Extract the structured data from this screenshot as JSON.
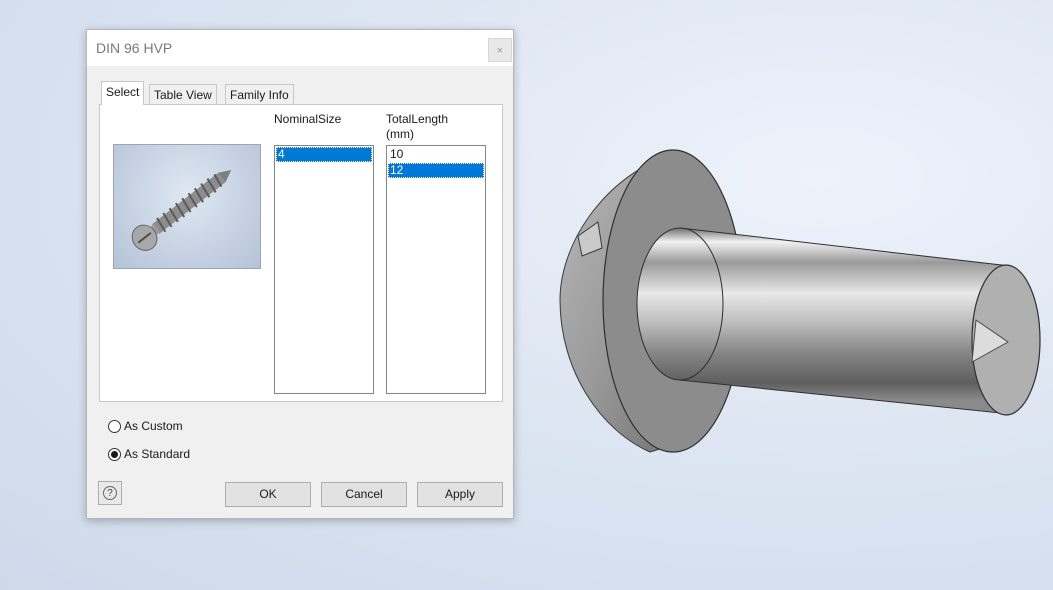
{
  "dialog": {
    "title": "DIN 96 HVP",
    "close_glyph": "×",
    "tabs": [
      {
        "label": "Select",
        "active": true
      },
      {
        "label": "Table View",
        "active": false
      },
      {
        "label": "Family Info",
        "active": false
      }
    ],
    "preview_image": "screw-thumbnail",
    "columns": [
      {
        "header": "NominalSize",
        "items": [
          {
            "value": "4",
            "selected": true
          }
        ]
      },
      {
        "header": "TotalLength",
        "header_unit": "(mm)",
        "items": [
          {
            "value": "10",
            "selected": false
          },
          {
            "value": "12",
            "selected": true
          }
        ]
      }
    ],
    "radios": [
      {
        "label": "As Custom",
        "checked": false
      },
      {
        "label": "As Standard",
        "checked": true
      }
    ],
    "help_glyph": "?",
    "buttons": {
      "ok": "OK",
      "cancel": "Cancel",
      "apply": "Apply"
    }
  },
  "viewport": {
    "model": "round-head-slotted-screw-3d"
  },
  "colors": {
    "selection": "#0078d7",
    "dialog_bg": "#f0f0f0",
    "viewport_bg": "#d8e2f0"
  }
}
